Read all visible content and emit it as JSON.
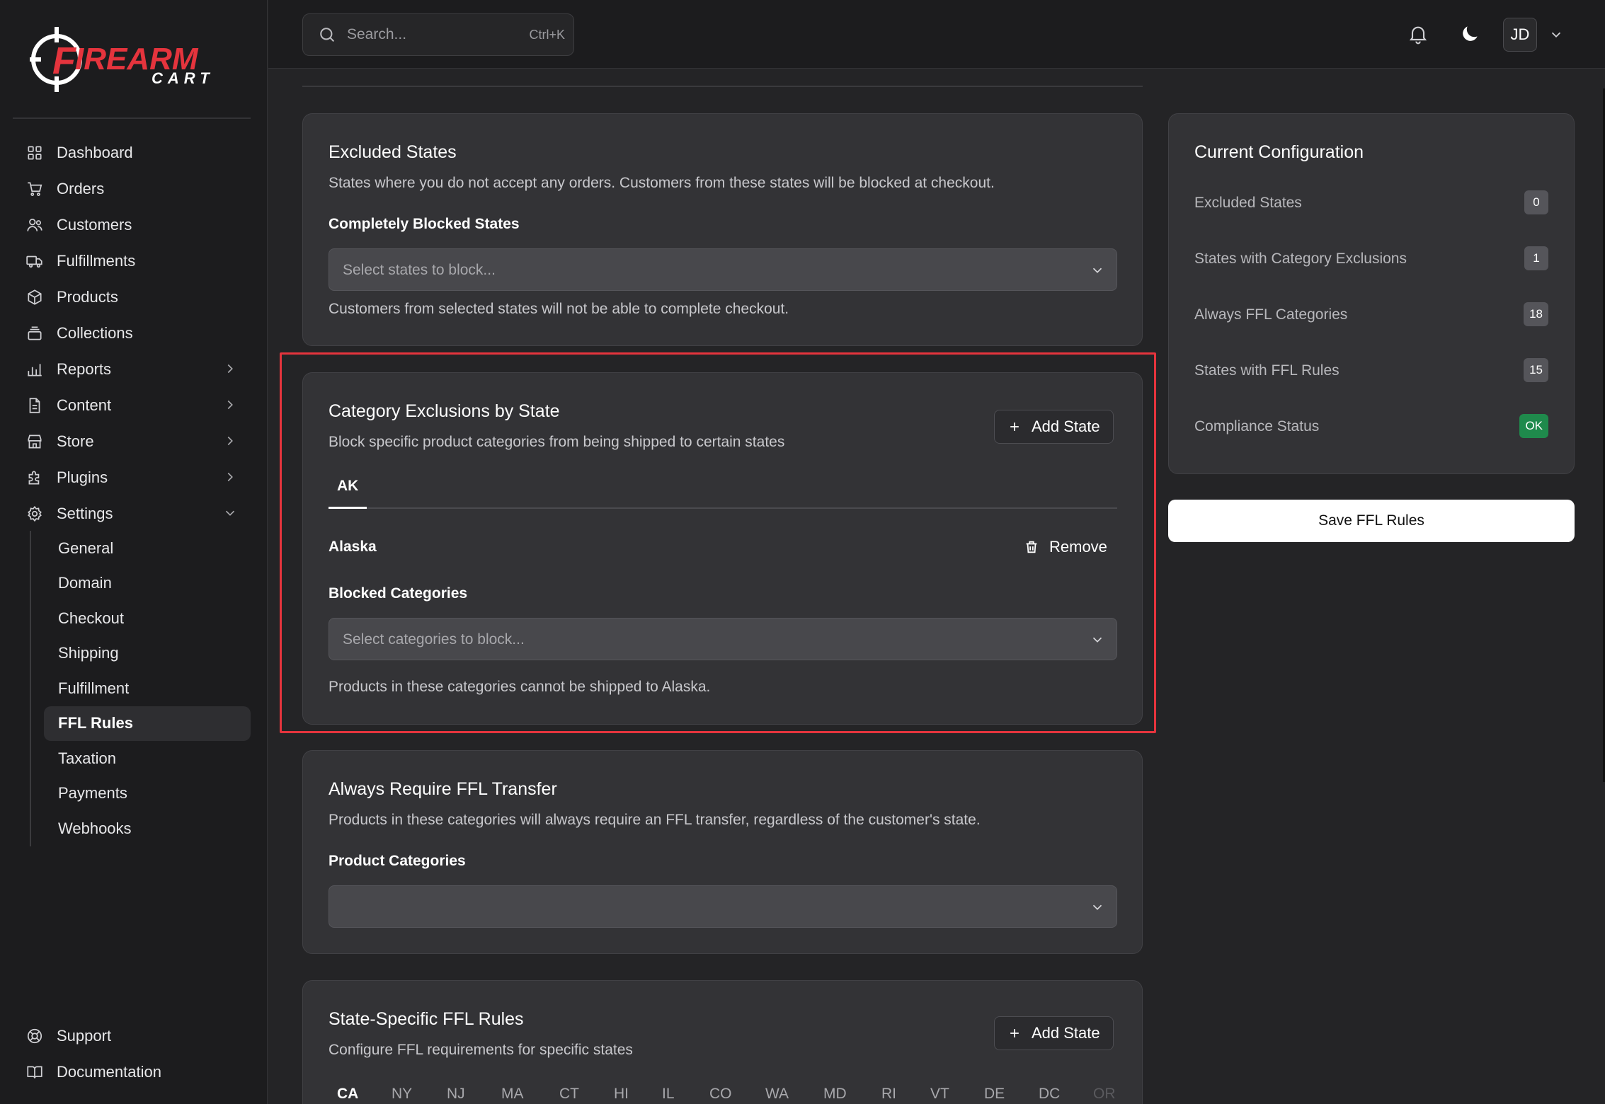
{
  "brand": {
    "name_line1": "FIREARM",
    "name_line2": "CART",
    "accent": "#e5343d"
  },
  "sidebar": {
    "items": [
      {
        "label": "Dashboard",
        "icon": "grid-icon"
      },
      {
        "label": "Orders",
        "icon": "cart-icon"
      },
      {
        "label": "Customers",
        "icon": "users-icon"
      },
      {
        "label": "Fulfillments",
        "icon": "truck-icon"
      },
      {
        "label": "Products",
        "icon": "box-icon"
      },
      {
        "label": "Collections",
        "icon": "stack-icon"
      },
      {
        "label": "Reports",
        "icon": "bar-chart-icon"
      },
      {
        "label": "Content",
        "icon": "file-icon"
      },
      {
        "label": "Store",
        "icon": "store-icon"
      },
      {
        "label": "Plugins",
        "icon": "puzzle-icon"
      },
      {
        "label": "Settings",
        "icon": "gear-icon"
      }
    ],
    "settings_sub": [
      "General",
      "Domain",
      "Checkout",
      "Shipping",
      "Fulfillment",
      "FFL Rules",
      "Taxation",
      "Payments",
      "Webhooks"
    ],
    "bottom": [
      {
        "label": "Support",
        "icon": "lifebuoy-icon"
      },
      {
        "label": "Documentation",
        "icon": "book-icon"
      }
    ]
  },
  "topbar": {
    "search_placeholder": "Search...",
    "search_shortcut": "Ctrl+K",
    "avatar_initials": "JD"
  },
  "excluded": {
    "title": "Excluded States",
    "desc": "States where you do not accept any orders. Customers from these states will be blocked at checkout.",
    "label": "Completely Blocked States",
    "placeholder": "Select states to block...",
    "help": "Customers from selected states will not be able to complete checkout."
  },
  "category_exclusions": {
    "title": "Category Exclusions by State",
    "desc": "Block specific product categories from being shipped to certain states",
    "add_label": "Add State",
    "tab": "AK",
    "state_name": "Alaska",
    "remove_label": "Remove",
    "label": "Blocked Categories",
    "placeholder": "Select categories to block...",
    "help": "Products in these categories cannot be shipped to Alaska."
  },
  "always_ffl": {
    "title": "Always Require FFL Transfer",
    "desc": "Products in these categories will always require an FFL transfer, regardless of the customer's state.",
    "label": "Product Categories"
  },
  "state_rules": {
    "title": "State-Specific FFL Rules",
    "desc": "Configure FFL requirements for specific states",
    "add_label": "Add State",
    "tabs": [
      "CA",
      "NY",
      "NJ",
      "MA",
      "CT",
      "HI",
      "IL",
      "CO",
      "WA",
      "MD",
      "RI",
      "VT",
      "DE",
      "DC",
      "OR"
    ]
  },
  "config": {
    "title": "Current Configuration",
    "rows": [
      {
        "label": "Excluded States",
        "value": "0"
      },
      {
        "label": "States with Category Exclusions",
        "value": "1"
      },
      {
        "label": "Always FFL Categories",
        "value": "18"
      },
      {
        "label": "States with FFL Rules",
        "value": "15"
      },
      {
        "label": "Compliance Status",
        "value": "OK"
      }
    ],
    "save_label": "Save FFL Rules"
  }
}
